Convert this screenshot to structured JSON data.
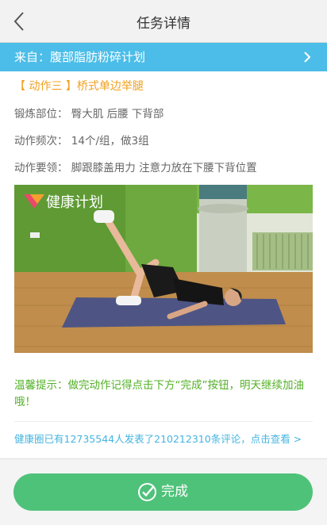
{
  "header": {
    "title": "任务详情"
  },
  "source": {
    "label": "来自：腹部脂肪粉碎计划"
  },
  "exercise": {
    "title": "【 动作三 】桥式单边举腿",
    "body_part": "锻炼部位：  臀大肌 后腰 下背部",
    "frequency": "动作频次：  14个/组，做3组",
    "key_points": "动作要领：  脚跟膝盖用力 注意力放在下腰下背位置"
  },
  "video": {
    "watermark": "健康计划"
  },
  "tip": {
    "text": "温馨提示：做完动作记得点击下方“完成”按钮，明天继续加油哦！"
  },
  "community": {
    "link_text": "健康圈已有12735544人发表了210212310条评论，点击查看  >"
  },
  "footer": {
    "done_label": "完成"
  },
  "colors": {
    "accent_blue": "#4bbde8",
    "title_orange": "#f0a020",
    "tip_green": "#52b026",
    "button_green": "#4fc27a"
  }
}
